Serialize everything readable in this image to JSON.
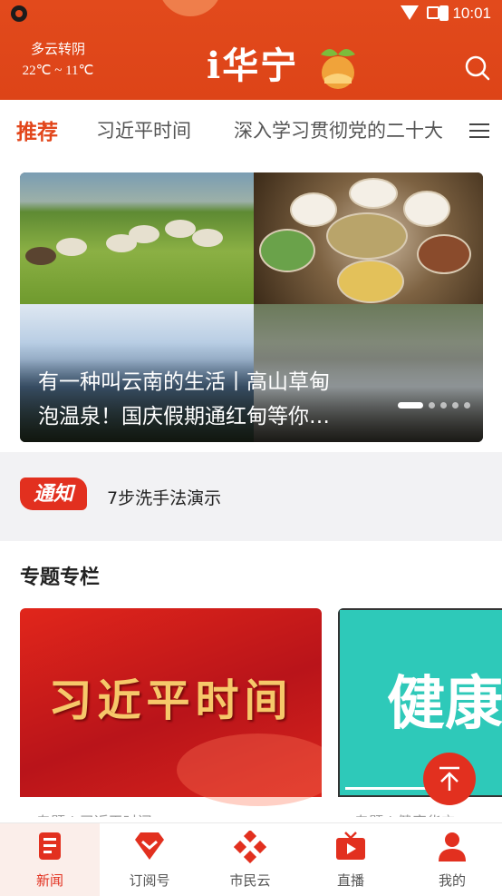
{
  "status_bar": {
    "time": "10:01"
  },
  "header": {
    "weather_condition": "多云转阴",
    "temperature_range": "22℃ ~ 11℃",
    "logo_text": "i华宁"
  },
  "tabs": [
    {
      "label": "推荐",
      "active": true
    },
    {
      "label": "习近平时间",
      "active": false
    },
    {
      "label": "深入学习贯彻党的二十大",
      "active": false
    }
  ],
  "carousel": {
    "caption_line1": "有一种叫云南的生活丨高山草甸",
    "caption_line2": "泡温泉！国庆假期通红甸等你…",
    "dot_count": 5,
    "active_dot": 0
  },
  "notice": {
    "badge": "通知",
    "text": "7步洗手法演示"
  },
  "topics": {
    "title": "专题专栏",
    "cards": [
      {
        "image_text": "习近平时间",
        "label": "专题 | 习近平时间"
      },
      {
        "image_text": "健康华",
        "label": "专题 | 健康华宁"
      }
    ]
  },
  "bottom_nav": [
    {
      "label": "新闻",
      "icon": "news-icon",
      "active": true
    },
    {
      "label": "订阅号",
      "icon": "subscribe-icon",
      "active": false
    },
    {
      "label": "市民云",
      "icon": "citizen-cloud-icon",
      "active": false
    },
    {
      "label": "直播",
      "icon": "live-tv-icon",
      "active": false
    },
    {
      "label": "我的",
      "icon": "profile-icon",
      "active": false
    }
  ],
  "colors": {
    "brand": "#e2461b",
    "accent_red": "#e2301f"
  }
}
